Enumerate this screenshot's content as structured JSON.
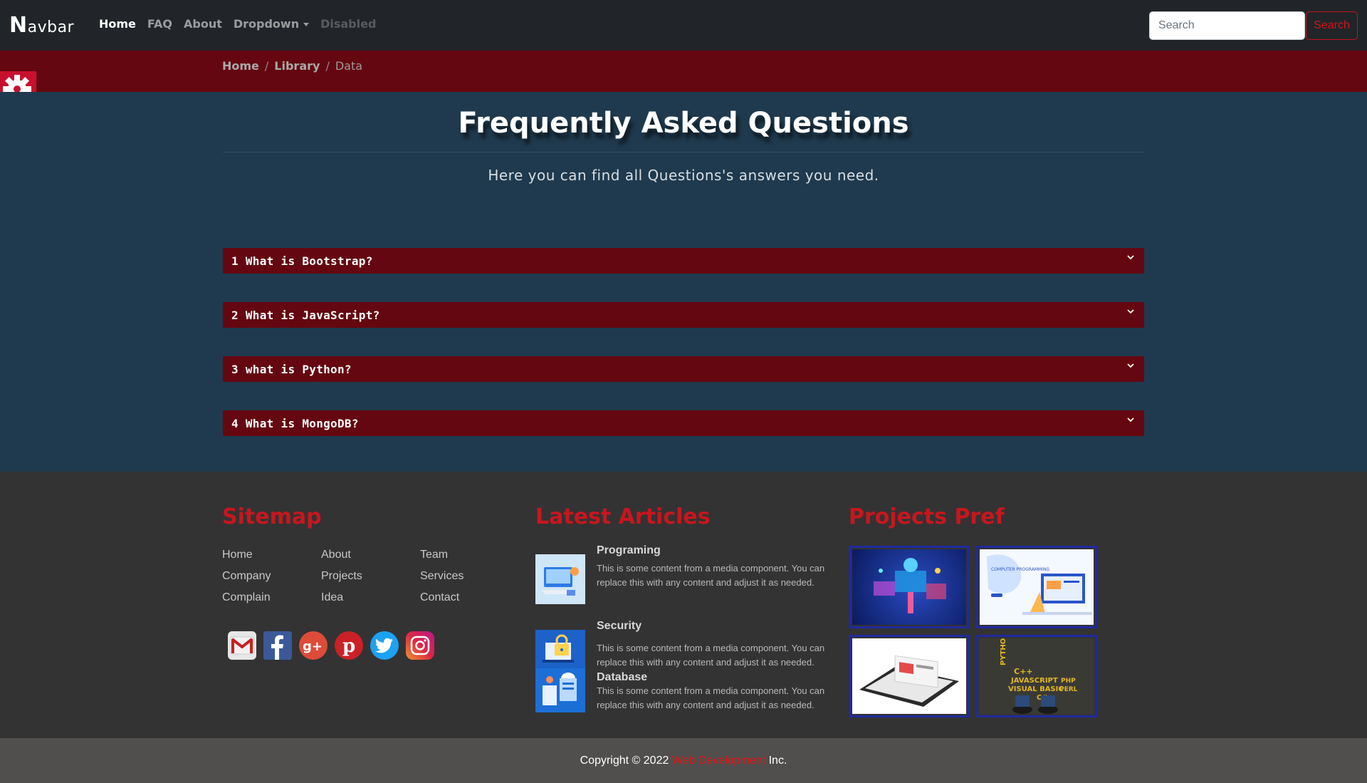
{
  "navbar": {
    "brand_first": "N",
    "brand_rest": "avbar",
    "links": [
      {
        "label": "Home",
        "state": "active"
      },
      {
        "label": "FAQ",
        "state": "normal"
      },
      {
        "label": "About",
        "state": "normal"
      },
      {
        "label": "Dropdown",
        "state": "normal"
      },
      {
        "label": "Disabled",
        "state": "disabled"
      }
    ],
    "search_placeholder": "Search",
    "search_button": "Search"
  },
  "breadcrumb": {
    "items": [
      "Home",
      "Library",
      "Data"
    ],
    "separator": "/"
  },
  "header": {
    "title": "Frequently Asked Questions",
    "subtitle": "Here you can find all Questions's answers you need."
  },
  "faq": [
    "1 What is Bootstrap?",
    "2 What is JavaScript?",
    "3 what is Python?",
    "4 What is MongoDB?"
  ],
  "footer": {
    "sitemap": {
      "title": "Sitemap",
      "links": [
        "Home",
        "About",
        "Team",
        "Company",
        "Projects",
        "Services",
        "Complain",
        "Idea",
        "Contact"
      ]
    },
    "socials": [
      "gmail-icon",
      "facebook-icon",
      "google-plus-icon",
      "pinterest-icon",
      "twitter-icon",
      "instagram-icon"
    ],
    "articles": {
      "title": "Latest Articles",
      "items": [
        {
          "title": "Programing",
          "text": "This is some content from a media component. You can replace this with any content and adjust it as needed."
        },
        {
          "title": "Security",
          "text": "This is some content from a media component. You can replace this with any content and adjust it as needed."
        },
        {
          "title": "Database",
          "text": "This is some content from a media component. You can replace this with any content and adjust it as needed."
        }
      ]
    },
    "projects": {
      "title": "Projects Pref",
      "image_text": {
        "computer_programming": "COMPUTER PROGRAMMING",
        "languages": [
          "PYTHON",
          "C++",
          "JAVASCRIPT",
          "PHP",
          "VISUAL BASIC",
          "PERL",
          "C#"
        ]
      }
    }
  },
  "copyright": {
    "prefix": "Copyright © 2022",
    "highlight": "Web Development",
    "suffix": "Inc."
  },
  "colors": {
    "navbar_bg": "#212529",
    "crimson": "#650710",
    "main_bg": "#1f3a4e",
    "accent_red": "#c8161e",
    "footer_bg": "#333333",
    "copyright_bg": "#514e4e"
  }
}
